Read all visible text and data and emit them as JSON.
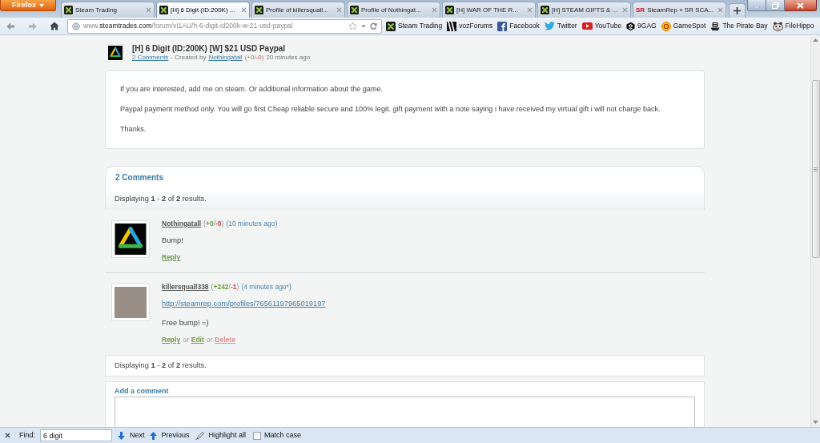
{
  "browser": {
    "menu_button": "Firefox",
    "tabs": [
      {
        "title": "Steam Trading",
        "kind": "steamtrades",
        "selected": false
      },
      {
        "title": "[H] 6 Digit (ID:200K) ...",
        "kind": "steamtrades",
        "selected": true
      },
      {
        "title": "Profile of killersquall...",
        "kind": "steamtrades",
        "selected": false
      },
      {
        "title": "Profile of Nothingat...",
        "kind": "steamtrades",
        "selected": false
      },
      {
        "title": "[H] WAR OF THE R...",
        "kind": "steamtrades",
        "selected": false
      },
      {
        "title": "[H] STEAM GIFTS & ...",
        "kind": "steamtrades",
        "selected": false
      },
      {
        "title": "SteamRep » SR SCA...",
        "kind": "steamrep",
        "logo": "SR",
        "selected": false
      }
    ]
  },
  "toolbar": {
    "url": {
      "prefix": "www.",
      "domain": "steamtrades.com",
      "path": "/forum/vI1AU/h-6-digit-id200k-w-21-usd-paypal"
    },
    "bookmarks": [
      {
        "label": "Steam Trading",
        "kind": "steamtrades"
      },
      {
        "label": "vozForums",
        "kind": "voz"
      },
      {
        "label": "Facebook",
        "kind": "facebook"
      },
      {
        "label": "Twitter",
        "kind": "twitter"
      },
      {
        "label": "YouTube",
        "kind": "youtube"
      },
      {
        "label": "9GAG",
        "kind": "ninegag"
      },
      {
        "label": "GameSpot",
        "kind": "gamespot"
      },
      {
        "label": "The Pirate Bay",
        "kind": "piratebay"
      },
      {
        "label": "FileHippo",
        "kind": "filehippo"
      }
    ]
  },
  "post": {
    "title": "[H] 6 Digit (ID:200K) [W] $21 USD Paypal",
    "comments_link": "2 Comments",
    "created_by": "- Created by",
    "author": "Nothingatall",
    "rep": [
      {
        "text": "(",
        "kind": "plain"
      },
      {
        "text": "+0",
        "kind": "plus"
      },
      {
        "text": "/",
        "kind": "plain"
      },
      {
        "text": "-0",
        "kind": "minus"
      },
      {
        "text": ")",
        "kind": "plain"
      }
    ],
    "time": "20 minutes ago",
    "paragraphs": [
      "If you are interested, add me on steam. Or additional information about the game.",
      "Paypal payment method only. You will go first Cheap reliable secure and 100% legit. gift payment with a note saying i have received my virtual gift i will not charge back.",
      "Thanks."
    ]
  },
  "comments": {
    "heading": "2 Comments",
    "summary": "Displaying **1** - **2** of **2** results.",
    "items": [
      {
        "author": "Nothingatall",
        "avatar": {
          "kind": "logo"
        },
        "rep": [
          {
            "text": "(",
            "kind": "plain"
          },
          {
            "text": "+0",
            "kind": "plus"
          },
          {
            "text": "/",
            "kind": "plain"
          },
          {
            "text": "-0",
            "kind": "minus"
          },
          {
            "text": ")",
            "kind": "plain"
          }
        ],
        "time": "(10 minutes ago)",
        "lines": [
          {
            "kind": "text",
            "text": "Bump!"
          }
        ],
        "actions": [
          {
            "kind": "reply",
            "text": "Reply"
          }
        ]
      },
      {
        "author": "killersquall338",
        "avatar": {
          "kind": "photo"
        },
        "rep": [
          {
            "text": "(",
            "kind": "plain"
          },
          {
            "text": "+242",
            "kind": "plus"
          },
          {
            "text": "/",
            "kind": "plain"
          },
          {
            "text": "-1",
            "kind": "minus"
          },
          {
            "text": ")",
            "kind": "plain"
          }
        ],
        "time": "(4 minutes ago*)",
        "lines": [
          {
            "kind": "link",
            "text": "http://steamrep.com/profiles/76561197965019197"
          },
          {
            "kind": "text",
            "text": "Free bump! =)"
          }
        ],
        "actions": [
          {
            "kind": "reply",
            "text": "Reply"
          },
          {
            "kind": "separator",
            "text": "or"
          },
          {
            "kind": "edit",
            "text": "Edit"
          },
          {
            "kind": "separator",
            "text": "or"
          },
          {
            "kind": "delete",
            "text": "Delete"
          }
        ]
      }
    ],
    "footer_summary": "Displaying **1** - **2** of **2** results."
  },
  "add_comment": {
    "heading": "Add a comment"
  },
  "find_bar": {
    "label": "Find:",
    "query": "6 digit",
    "buttons": [
      {
        "kind": "next",
        "label": "Next"
      },
      {
        "kind": "previous",
        "label": "Previous"
      },
      {
        "kind": "highlight",
        "label": "Highlight all"
      }
    ],
    "match_case": {
      "label": "Match case",
      "checked": false
    }
  }
}
